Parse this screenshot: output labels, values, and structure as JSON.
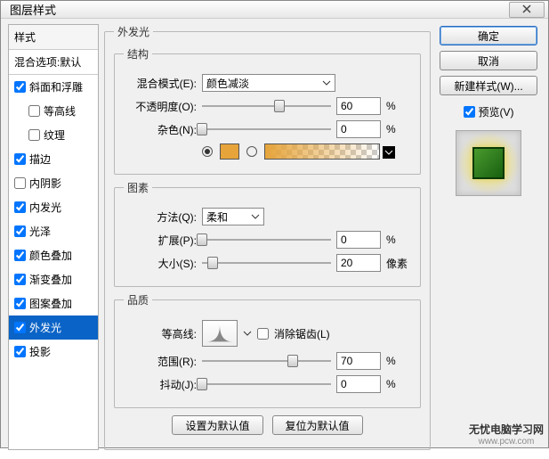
{
  "window": {
    "title": "图层样式"
  },
  "sidebar": {
    "header": "样式",
    "sub": "混合选项:默认",
    "items": [
      {
        "label": "斜面和浮雕",
        "checked": true,
        "indent": false
      },
      {
        "label": "等高线",
        "checked": false,
        "indent": true
      },
      {
        "label": "纹理",
        "checked": false,
        "indent": true
      },
      {
        "label": "描边",
        "checked": true,
        "indent": false
      },
      {
        "label": "内阴影",
        "checked": false,
        "indent": false
      },
      {
        "label": "内发光",
        "checked": true,
        "indent": false
      },
      {
        "label": "光泽",
        "checked": true,
        "indent": false
      },
      {
        "label": "颜色叠加",
        "checked": true,
        "indent": false
      },
      {
        "label": "渐变叠加",
        "checked": true,
        "indent": false
      },
      {
        "label": "图案叠加",
        "checked": true,
        "indent": false
      },
      {
        "label": "外发光",
        "checked": true,
        "indent": false,
        "selected": true
      },
      {
        "label": "投影",
        "checked": true,
        "indent": false
      }
    ]
  },
  "panel": {
    "title": "外发光",
    "structure": {
      "legend": "结构",
      "blend_label": "混合模式(E):",
      "blend_value": "颜色减淡",
      "opacity_label": "不透明度(O):",
      "opacity_value": "60",
      "opacity_unit": "%",
      "noise_label": "杂色(N):",
      "noise_value": "0",
      "noise_unit": "%",
      "solid_color": "#e6a43a"
    },
    "elements": {
      "legend": "图素",
      "method_label": "方法(Q):",
      "method_value": "柔和",
      "spread_label": "扩展(P):",
      "spread_value": "0",
      "spread_unit": "%",
      "size_label": "大小(S):",
      "size_value": "20",
      "size_unit": "像素"
    },
    "quality": {
      "legend": "品质",
      "contour_label": "等高线:",
      "aa_label": "消除锯齿(L)",
      "range_label": "范围(R):",
      "range_value": "70",
      "range_unit": "%",
      "jitter_label": "抖动(J):",
      "jitter_value": "0",
      "jitter_unit": "%"
    },
    "buttons": {
      "set_default": "设置为默认值",
      "reset_default": "复位为默认值"
    }
  },
  "right": {
    "ok": "确定",
    "cancel": "取消",
    "new_style": "新建样式(W)...",
    "preview": "预览(V)"
  },
  "watermark": {
    "main": "无忧电脑学习网",
    "sub": "www.pcw.com"
  }
}
